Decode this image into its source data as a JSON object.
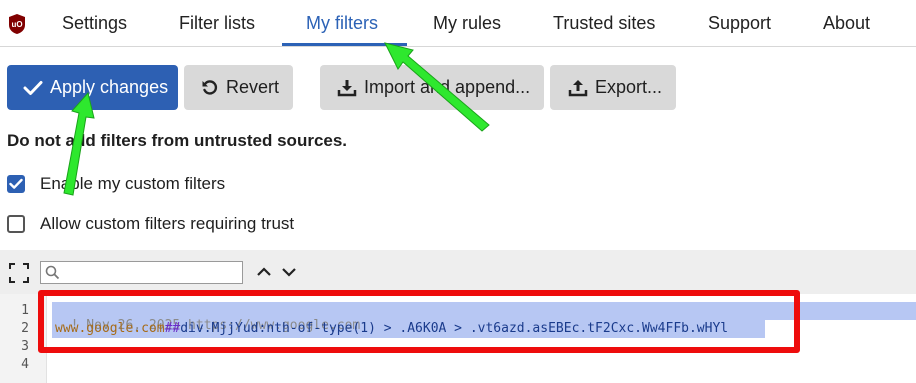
{
  "nav": {
    "tabs": [
      {
        "label": "Settings"
      },
      {
        "label": "Filter lists"
      },
      {
        "label": "My filters",
        "active": true
      },
      {
        "label": "My rules"
      },
      {
        "label": "Trusted sites"
      },
      {
        "label": "Support"
      },
      {
        "label": "About"
      }
    ]
  },
  "toolbar": {
    "apply_label": "Apply changes",
    "revert_label": "Revert",
    "import_label": "Import and append...",
    "export_label": "Export..."
  },
  "warning": "Do not add filters from untrusted sources.",
  "options": {
    "enable_custom": {
      "label": "Enable my custom filters",
      "checked": true
    },
    "allow_trust": {
      "label": "Allow custom filters requiring trust",
      "checked": false
    }
  },
  "search": {
    "value": "",
    "placeholder": ""
  },
  "editor": {
    "line_numbers": [
      "1",
      "2",
      "3",
      "4"
    ],
    "line1": "! Nov 26, 2025 https://www.google.com",
    "line2_domain": "www.google.com",
    "line2_sep": "##",
    "line2_selector": "div.MjjYud:nth-of-type(1) > .A6K0A > .vt6azd.asEBEc.tF2Cxc.Ww4FFb.wHYl"
  },
  "colors": {
    "accent": "#2d60b3",
    "annotation_box": "#ee0c0c",
    "annotation_arrow": "#2ee82e",
    "selection": "#b7c7f3"
  },
  "icons": [
    "ublock-logo-icon",
    "checkmark-icon",
    "undo-icon",
    "import-icon",
    "export-icon",
    "fullscreen-icon",
    "search-icon",
    "chevron-up-icon",
    "chevron-down-icon"
  ]
}
